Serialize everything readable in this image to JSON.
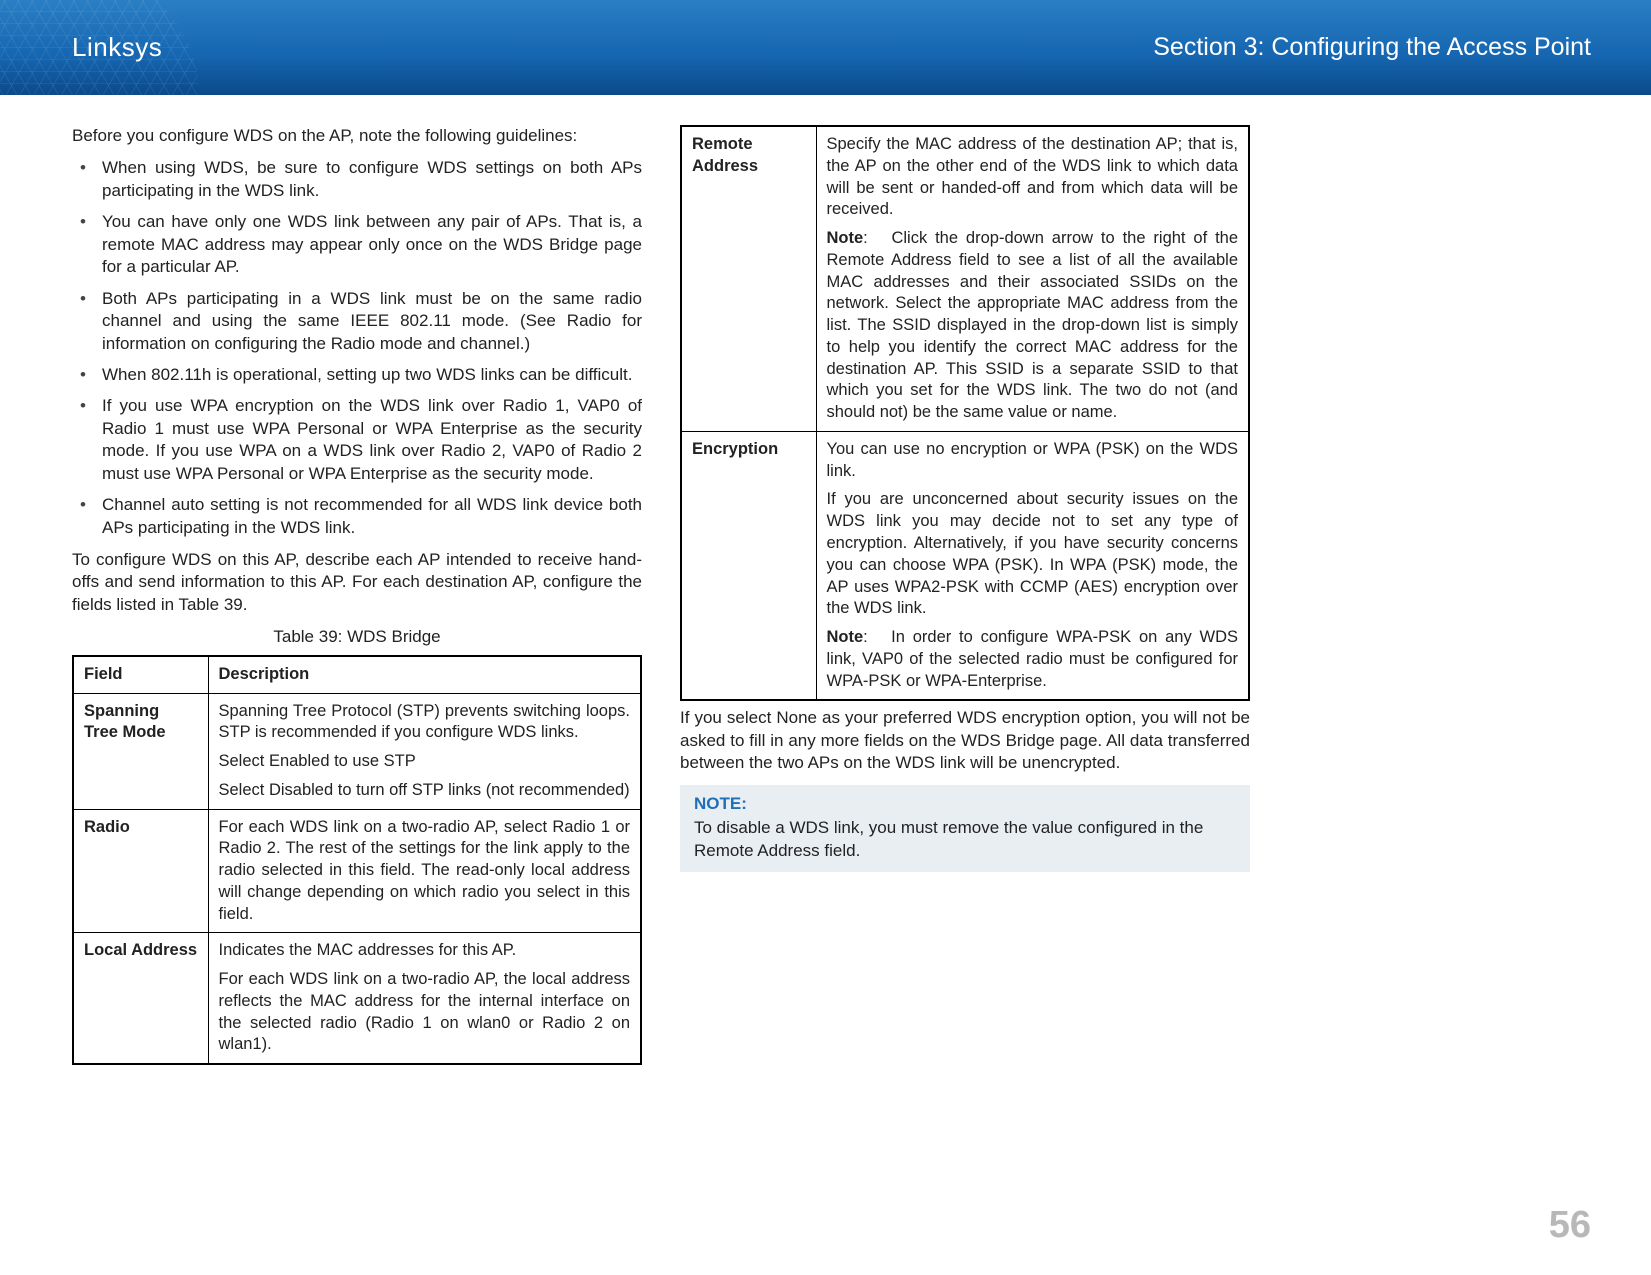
{
  "header": {
    "brand": "Linksys",
    "section": "Section 3:  Configuring the Access Point"
  },
  "left": {
    "intro": "Before you configure WDS on the AP, note the following guidelines:",
    "bullets": [
      "When using WDS, be sure to configure WDS settings on both APs participating in the WDS link.",
      "You can have only one WDS link between any pair of APs. That is, a remote MAC address may appear only once on the WDS Bridge page for a particular AP.",
      "Both APs participating in a WDS link must be on the same radio channel and using the same IEEE 802.11 mode. (See Radio for information on configuring the Radio mode and channel.)",
      "When 802.11h is operational, setting up two WDS links can be difficult.",
      "If you use WPA encryption on the WDS link over Radio 1, VAP0 of Radio 1 must use WPA Personal or WPA Enterprise as the security mode. If you use WPA on a WDS link over Radio 2, VAP0 of Radio 2 must use WPA Personal or WPA Enterprise as the security mode.",
      "Channel auto setting is not recommended for all WDS link device both APs participating in the WDS link."
    ],
    "configure_para": "To configure WDS on this AP, describe each AP intended to receive hand-offs and send information to this AP. For each destination AP, configure the fields listed in Table 39.",
    "table_caption": "Table 39: WDS Bridge",
    "table_headers": {
      "field": "Field",
      "desc": "Description"
    },
    "rows": [
      {
        "field": "Spanning Tree Mode",
        "desc": [
          "Spanning Tree Protocol (STP) prevents switching loops. STP is recommended if you configure WDS links.",
          "Select Enabled to use STP",
          "Select Disabled to turn off STP links (not recommended)"
        ]
      },
      {
        "field": "Radio",
        "desc": [
          "For each WDS link on a two-radio AP, select Radio 1 or Radio 2. The rest of the settings for the link apply to the radio selected in this field. The read-only local address will change depending on which radio you select in this field."
        ]
      },
      {
        "field": "Local Address",
        "desc": [
          "Indicates the MAC addresses for this AP.",
          "For each WDS link on a two-radio AP, the local address reflects the MAC address for the internal interface on the selected radio (Radio 1 on wlan0 or Radio 2 on wlan1)."
        ]
      }
    ]
  },
  "right": {
    "rows": [
      {
        "field": "Remote Address",
        "desc": [
          "Specify the MAC address of the destination AP; that is, the AP on the other end of the WDS link to which data will be sent or handed-off and from which data will be received.",
          {
            "note_label": "Note",
            "text": "Click the drop-down arrow to the right of the Remote Address field to see a list of all the available MAC addresses and their associated SSIDs on the network. Select the appropriate MAC address from the list. The SSID displayed in the drop-down list is simply to help you identify the correct MAC address for the destination AP. This SSID is a separate SSID to that which you set for the WDS link. The two do not (and should not) be the same value or name."
          }
        ]
      },
      {
        "field": "Encryption",
        "desc": [
          "You can use no encryption or WPA (PSK) on the WDS link.",
          "If you are unconcerned about security issues on the WDS link you may decide not to set any type of encryption. Alternatively, if you have security concerns you can choose WPA (PSK). In WPA (PSK) mode, the AP uses WPA2-PSK with CCMP (AES) encryption over the WDS link.",
          {
            "note_label": "Note",
            "text": "In order to configure WPA-PSK on any WDS link, VAP0 of the selected radio must be configured for WPA-PSK or WPA-Enterprise."
          }
        ]
      }
    ],
    "after_table": "If you select None as your preferred WDS encryption option, you will not be asked to fill in any more fields on the WDS Bridge page. All data transferred between the two APs on the WDS link will be unencrypted.",
    "note_box": {
      "head": "NOTE:",
      "body": "To disable a WDS link, you must remove the value configured in the Remote Address field."
    }
  },
  "page_number": "56"
}
